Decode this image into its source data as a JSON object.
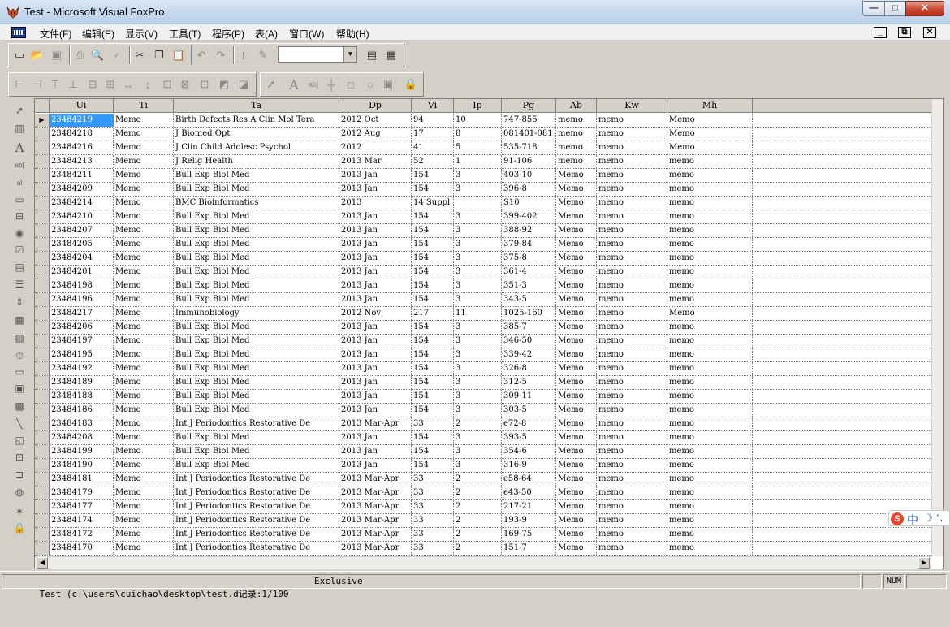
{
  "window": {
    "title": "Test - Microsoft Visual FoxPro"
  },
  "window_controls": {
    "minimize": "—",
    "maximize": "□",
    "close": "✕"
  },
  "menu": {
    "items": [
      "文件(F)",
      "编辑(E)",
      "显示(V)",
      "工具(T)",
      "程序(P)",
      "表(A)",
      "窗口(W)",
      "帮助(H)"
    ],
    "doc_controls": [
      "_",
      "⧉",
      "✕"
    ]
  },
  "toolbar_standard": {
    "icons": [
      "new-icon",
      "open-icon",
      "save-icon",
      "print-icon",
      "print-preview-icon",
      "spell-check-icon",
      "cut-icon",
      "copy-icon",
      "paste-icon",
      "undo-icon",
      "redo-icon",
      "run-icon",
      "modify-form-icon",
      "command-window-icon",
      "data-session-icon"
    ],
    "combo_value": ""
  },
  "grid": {
    "columns": [
      "Ui",
      "Ti",
      "Ta",
      "Dp",
      "Vi",
      "Ip",
      "Pg",
      "Ab",
      "Kw",
      "Mh"
    ],
    "rows": [
      [
        "23484219",
        "Memo",
        "Birth Defects Res A Clin Mol Tera",
        "2012 Oct",
        "94",
        "10",
        "747-855",
        "memo",
        "memo",
        "Memo"
      ],
      [
        "23484218",
        "Memo",
        "J Biomed Opt",
        "2012 Aug",
        "17",
        "8",
        "081401-081",
        "memo",
        "memo",
        "Memo"
      ],
      [
        "23484216",
        "Memo",
        "J Clin Child Adolesc Psychol",
        "2012",
        "41",
        "5",
        "535-718",
        "memo",
        "memo",
        "Memo"
      ],
      [
        "23484213",
        "Memo",
        "J Relig Health",
        "2013 Mar",
        "52",
        "1",
        "91-106",
        "memo",
        "memo",
        "memo"
      ],
      [
        "23484211",
        "Memo",
        "Bull Exp Biol Med",
        "2013 Jan",
        "154",
        "3",
        "403-10",
        "Memo",
        "memo",
        "memo"
      ],
      [
        "23484209",
        "Memo",
        "Bull Exp Biol Med",
        "2013 Jan",
        "154",
        "3",
        "396-8",
        "Memo",
        "memo",
        "memo"
      ],
      [
        "23484214",
        "Memo",
        "BMC Bioinformatics",
        "2013",
        "14 Suppl",
        "",
        "S10",
        "Memo",
        "memo",
        "memo"
      ],
      [
        "23484210",
        "Memo",
        "Bull Exp Biol Med",
        "2013 Jan",
        "154",
        "3",
        "399-402",
        "Memo",
        "memo",
        "memo"
      ],
      [
        "23484207",
        "Memo",
        "Bull Exp Biol Med",
        "2013 Jan",
        "154",
        "3",
        "388-92",
        "Memo",
        "memo",
        "memo"
      ],
      [
        "23484205",
        "Memo",
        "Bull Exp Biol Med",
        "2013 Jan",
        "154",
        "3",
        "379-84",
        "Memo",
        "memo",
        "memo"
      ],
      [
        "23484204",
        "Memo",
        "Bull Exp Biol Med",
        "2013 Jan",
        "154",
        "3",
        "375-8",
        "Memo",
        "memo",
        "memo"
      ],
      [
        "23484201",
        "Memo",
        "Bull Exp Biol Med",
        "2013 Jan",
        "154",
        "3",
        "361-4",
        "Memo",
        "memo",
        "memo"
      ],
      [
        "23484198",
        "Memo",
        "Bull Exp Biol Med",
        "2013 Jan",
        "154",
        "3",
        "351-3",
        "Memo",
        "memo",
        "memo"
      ],
      [
        "23484196",
        "Memo",
        "Bull Exp Biol Med",
        "2013 Jan",
        "154",
        "3",
        "343-5",
        "Memo",
        "memo",
        "memo"
      ],
      [
        "23484217",
        "Memo",
        "Immunobiology",
        "2012 Nov",
        "217",
        "11",
        "1025-160",
        "Memo",
        "memo",
        "Memo"
      ],
      [
        "23484206",
        "Memo",
        "Bull Exp Biol Med",
        "2013 Jan",
        "154",
        "3",
        "385-7",
        "Memo",
        "memo",
        "memo"
      ],
      [
        "23484197",
        "Memo",
        "Bull Exp Biol Med",
        "2013 Jan",
        "154",
        "3",
        "346-50",
        "Memo",
        "memo",
        "memo"
      ],
      [
        "23484195",
        "Memo",
        "Bull Exp Biol Med",
        "2013 Jan",
        "154",
        "3",
        "339-42",
        "Memo",
        "memo",
        "memo"
      ],
      [
        "23484192",
        "Memo",
        "Bull Exp Biol Med",
        "2013 Jan",
        "154",
        "3",
        "326-8",
        "Memo",
        "memo",
        "memo"
      ],
      [
        "23484189",
        "Memo",
        "Bull Exp Biol Med",
        "2013 Jan",
        "154",
        "3",
        "312-5",
        "Memo",
        "memo",
        "memo"
      ],
      [
        "23484188",
        "Memo",
        "Bull Exp Biol Med",
        "2013 Jan",
        "154",
        "3",
        "309-11",
        "Memo",
        "memo",
        "memo"
      ],
      [
        "23484186",
        "Memo",
        "Bull Exp Biol Med",
        "2013 Jan",
        "154",
        "3",
        "303-5",
        "Memo",
        "memo",
        "memo"
      ],
      [
        "23484183",
        "Memo",
        "Int J Periodontics Restorative De",
        "2013 Mar-Apr",
        "33",
        "2",
        "e72-8",
        "Memo",
        "memo",
        "memo"
      ],
      [
        "23484208",
        "Memo",
        "Bull Exp Biol Med",
        "2013 Jan",
        "154",
        "3",
        "393-5",
        "Memo",
        "memo",
        "memo"
      ],
      [
        "23484199",
        "Memo",
        "Bull Exp Biol Med",
        "2013 Jan",
        "154",
        "3",
        "354-6",
        "Memo",
        "memo",
        "memo"
      ],
      [
        "23484190",
        "Memo",
        "Bull Exp Biol Med",
        "2013 Jan",
        "154",
        "3",
        "316-9",
        "Memo",
        "memo",
        "memo"
      ],
      [
        "23484181",
        "Memo",
        "Int J Periodontics Restorative De",
        "2013 Mar-Apr",
        "33",
        "2",
        "e58-64",
        "Memo",
        "memo",
        "memo"
      ],
      [
        "23484179",
        "Memo",
        "Int J Periodontics Restorative De",
        "2013 Mar-Apr",
        "33",
        "2",
        "e43-50",
        "Memo",
        "memo",
        "memo"
      ],
      [
        "23484177",
        "Memo",
        "Int J Periodontics Restorative De",
        "2013 Mar-Apr",
        "33",
        "2",
        "217-21",
        "Memo",
        "memo",
        "memo"
      ],
      [
        "23484174",
        "Memo",
        "Int J Periodontics Restorative De",
        "2013 Mar-Apr",
        "33",
        "2",
        "193-9",
        "Memo",
        "memo",
        "memo"
      ],
      [
        "23484172",
        "Memo",
        "Int J Periodontics Restorative De",
        "2013 Mar-Apr",
        "33",
        "2",
        "169-75",
        "Memo",
        "memo",
        "memo"
      ],
      [
        "23484170",
        "Memo",
        "Int J Periodontics Restorative De",
        "2013 Mar-Apr",
        "33",
        "2",
        "151-7",
        "Memo",
        "memo",
        "memo"
      ]
    ],
    "selected_row": 0,
    "current_marker": "▶"
  },
  "ime": {
    "logo": "S",
    "mode": "中",
    "moon": "☽",
    "extra": "°,"
  },
  "status": {
    "path": "Test (c:\\users\\cuichao\\desktop\\test.d记录:1/100",
    "mode": "Exclusive",
    "num": "NUM"
  },
  "colors": {
    "selection": "#3399ff",
    "titlebar": "#c6d9ee",
    "close_button": "#c7462f"
  }
}
